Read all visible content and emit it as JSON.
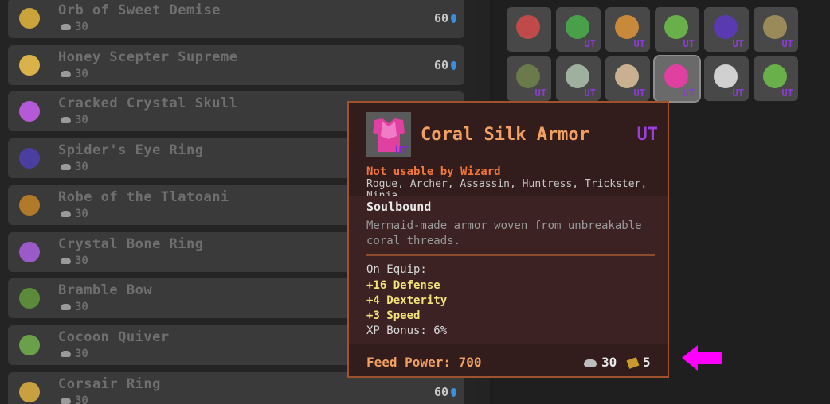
{
  "list": {
    "items": [
      {
        "name": "Orb of Sweet Demise",
        "fame": "30",
        "power": "60",
        "icon": "orb-icon",
        "color": "#c9a43a"
      },
      {
        "name": "Honey Scepter Supreme",
        "fame": "30",
        "power": "60",
        "icon": "scepter-icon",
        "color": "#d9b24a"
      },
      {
        "name": "Cracked Crystal Skull",
        "fame": "30",
        "power": "",
        "icon": "skull-icon",
        "color": "#b55ad6"
      },
      {
        "name": "Spider's Eye Ring",
        "fame": "30",
        "power": "",
        "icon": "ring-icon",
        "color": "#4a3fa0"
      },
      {
        "name": "Robe of the Tlatoani",
        "fame": "30",
        "power": "",
        "icon": "robe-icon",
        "color": "#b07a2a"
      },
      {
        "name": "Crystal Bone Ring",
        "fame": "30",
        "power": "",
        "icon": "ring-icon",
        "color": "#9a5ac8"
      },
      {
        "name": "Bramble Bow",
        "fame": "30",
        "power": "",
        "icon": "bow-icon",
        "color": "#5a8a3a"
      },
      {
        "name": "Cocoon Quiver",
        "fame": "30",
        "power": "",
        "icon": "quiver-icon",
        "color": "#6aa04a"
      },
      {
        "name": "Corsair Ring",
        "fame": "30",
        "power": "60",
        "icon": "ring-icon",
        "color": "#c8a040"
      }
    ]
  },
  "grid": {
    "slots": [
      {
        "icon": "skull-mask-icon",
        "tier": "",
        "color": "#c04a4a"
      },
      {
        "icon": "staff-icon",
        "tier": "UT",
        "color": "#4aa04a"
      },
      {
        "icon": "amulet-icon",
        "tier": "UT",
        "color": "#c88a3a"
      },
      {
        "icon": "necklace-icon",
        "tier": "UT",
        "color": "#6ab04a"
      },
      {
        "icon": "orb-icon",
        "tier": "UT",
        "color": "#5a3ab0"
      },
      {
        "icon": "shield-icon",
        "tier": "UT",
        "color": "#9a8a5a"
      },
      {
        "icon": "bow-icon",
        "tier": "UT",
        "color": "#6a7a4a"
      },
      {
        "icon": "skull-icon",
        "tier": "UT",
        "color": "#a0b0a0"
      },
      {
        "icon": "hat-icon",
        "tier": "UT",
        "color": "#c8b090"
      },
      {
        "icon": "armor-icon",
        "tier": "UT",
        "color": "#e040a0"
      },
      {
        "icon": "hood-icon",
        "tier": "UT",
        "color": "#d0d0d0"
      },
      {
        "icon": "dagger-icon",
        "tier": "UT",
        "color": "#6ab04a"
      }
    ]
  },
  "tooltip": {
    "name": "Coral Silk Armor",
    "tier": "UT",
    "icon": "armor-icon",
    "icon_tier": "UT",
    "not_usable": "Not usable by Wizard",
    "classes": "Rogue, Archer, Assassin, Huntress, Trickster, Ninja",
    "soulbound": "Soulbound",
    "description": "Mermaid-made armor woven from unbreakable coral threads.",
    "on_equip": "On Equip:",
    "stats": [
      "+16 Defense",
      "+4 Dexterity",
      "+3 Speed"
    ],
    "xp_bonus": "XP Bonus: 6%",
    "feed_power": "Feed Power: 700",
    "fame": "30",
    "cost": "5"
  },
  "colors": {
    "accent_orange": "#f0a060",
    "tier_purple": "#9d3de0",
    "arrow_magenta": "#ff00ff"
  }
}
